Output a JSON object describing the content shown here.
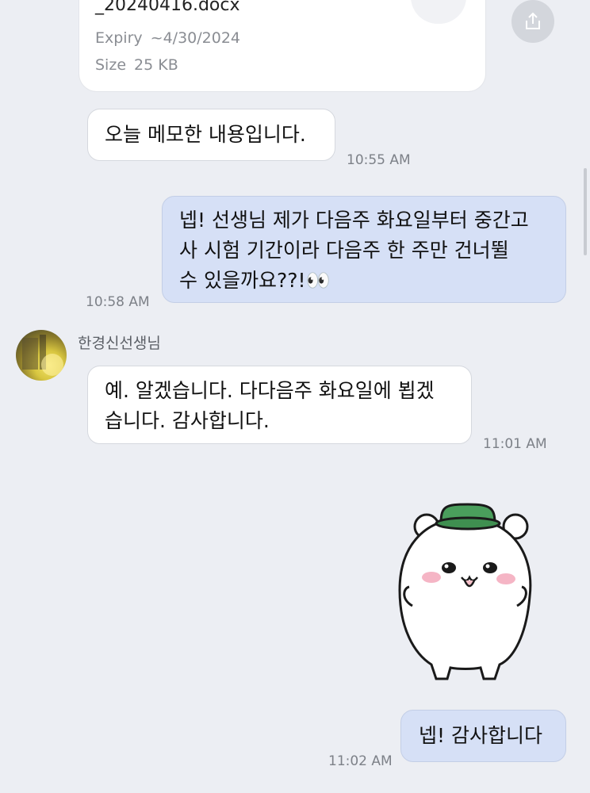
{
  "file_card": {
    "filename": "_20240416.docx",
    "expiry_label": "Expiry",
    "expiry_value": "~4/30/2024",
    "size_label": "Size",
    "size_value": "25 KB"
  },
  "messages": [
    {
      "direction": "incoming",
      "text": "오늘 메모한 내용입니다.",
      "time": "10:55 AM"
    },
    {
      "direction": "outgoing",
      "lines": [
        "넵! 선생님 제가 다음주 화요일부터 중간고",
        "사 시험 기간이라 다음주 한 주만 건너뛸",
        "수 있을까요??!👀"
      ],
      "time": "10:58 AM"
    },
    {
      "direction": "incoming",
      "sender": "한경신선생님",
      "lines": [
        "예. 알겠습니다.  다다음주 화요일에 뵙겠",
        "습니다. 감사합니다."
      ],
      "time": "11:01 AM"
    },
    {
      "direction": "outgoing",
      "type": "sticker",
      "sticker": "white-bear-green-hat-sticker"
    },
    {
      "direction": "outgoing",
      "text": "넵! 감사합니다",
      "time": "11:02 AM"
    }
  ],
  "icons": {
    "download": "download-icon",
    "share": "share-icon"
  },
  "colors": {
    "background": "#eceef3",
    "outgoing_bubble": "#d6e0f6",
    "incoming_bubble": "#ffffff"
  }
}
